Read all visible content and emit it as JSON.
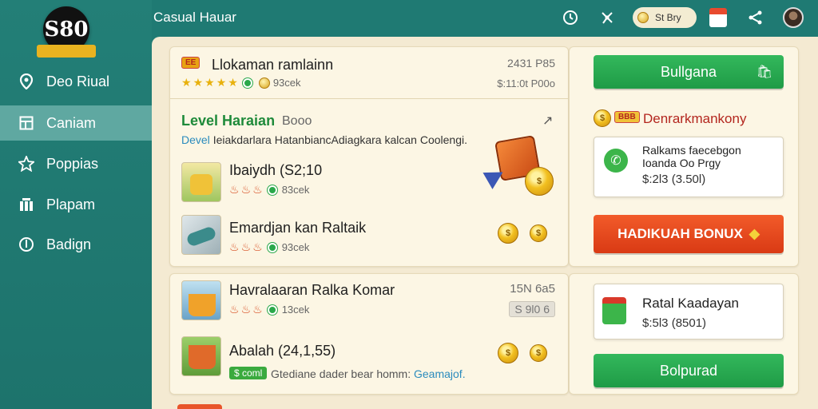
{
  "app": {
    "title": "Casual Hauar",
    "logo_text": "S80"
  },
  "sidebar": {
    "items": [
      {
        "label": "Deo Riual",
        "icon": "location-pin-icon"
      },
      {
        "label": "Caniam",
        "icon": "layout-icon"
      },
      {
        "label": "Poppias",
        "icon": "star-icon"
      },
      {
        "label": "Plapam",
        "icon": "grid-icon"
      },
      {
        "label": "Badign",
        "icon": "badge-icon"
      }
    ],
    "active_index": 1
  },
  "topbar": {
    "coin_label": "St Bry"
  },
  "section1": {
    "header_badge": "ЕЕ",
    "title": "Llokaman ramlainn",
    "meta1": "2431 P85",
    "meta2": "$:11:0t P00o",
    "rating_note": "93cek",
    "level_title": "Level Haraian",
    "level_sub": "Booo",
    "level_desc_prefix": "Devel",
    "level_desc": "Ieiakdarlara HatanbiancAdiagkara kalcan Coolengi.",
    "items": [
      {
        "title": "Ibaiydh (S2;10",
        "note": "83cek"
      },
      {
        "title": "Emardjan kan Raltaik",
        "note": "93cek"
      }
    ]
  },
  "section2": {
    "title": "Havralaaran Ralka Komar",
    "meta": "15N 6a5",
    "chip": "S 9l0 6",
    "rating_note": "13cek",
    "item2_title": "Abalah (24,1,55)",
    "item2_chip": "$ coml",
    "footer_text": "Gtediane dader bear homm:",
    "footer_link": "Geamajof."
  },
  "right_panel": {
    "btn1": "Bullgana",
    "promo_badge": "BBB",
    "promo_title": "Denrarkmankony",
    "box1": {
      "line1": "Ralkams faecebgon",
      "line2": "Ioanda Oo Prgy",
      "price": "$:2l3 (3.50l)"
    },
    "bonus_btn": "HADIKUAH BONUX",
    "box2": {
      "title": "Ratal Kaadayan",
      "price": "$:5l3 (8501)"
    },
    "btn2": "Bolpurad"
  },
  "colors": {
    "sidebar": "#237f77",
    "panel": "#f4ead2",
    "green": "#2aa84a",
    "red": "#e84a1e",
    "gold": "#e8b10e"
  }
}
